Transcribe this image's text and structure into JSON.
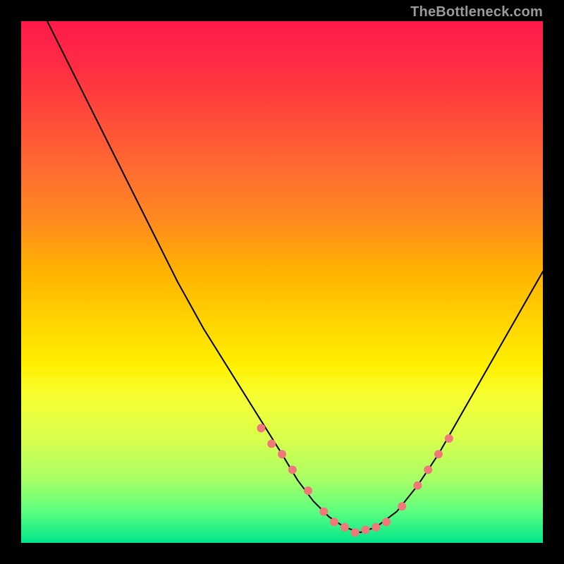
{
  "watermark": "TheBottleneck.com",
  "chart_data": {
    "type": "line",
    "title": "",
    "xlabel": "",
    "ylabel": "",
    "xlim": [
      0,
      100
    ],
    "ylim": [
      0,
      100
    ],
    "grid": false,
    "legend": false,
    "series": [
      {
        "name": "curve",
        "color": "#000000",
        "x": [
          5,
          10,
          15,
          20,
          25,
          30,
          35,
          40,
          45,
          50,
          53,
          56,
          59,
          62,
          65,
          68,
          72,
          76,
          80,
          84,
          88,
          92,
          96,
          100
        ],
        "y": [
          100,
          90,
          80,
          70,
          60,
          50,
          41,
          33,
          25,
          17,
          12,
          8,
          5,
          3,
          2,
          3,
          6,
          11,
          17,
          24,
          31,
          38,
          45,
          52
        ]
      }
    ],
    "markers": {
      "name": "dots",
      "color": "#f07878",
      "radius_px": 6,
      "x": [
        46,
        48,
        50,
        52,
        55,
        58,
        60,
        62,
        64,
        66,
        68,
        70,
        73,
        76,
        78,
        80,
        82
      ],
      "y": [
        22,
        19,
        17,
        14,
        10,
        6,
        4,
        3,
        2,
        2.5,
        3,
        4,
        7,
        11,
        14,
        17,
        20
      ]
    }
  }
}
